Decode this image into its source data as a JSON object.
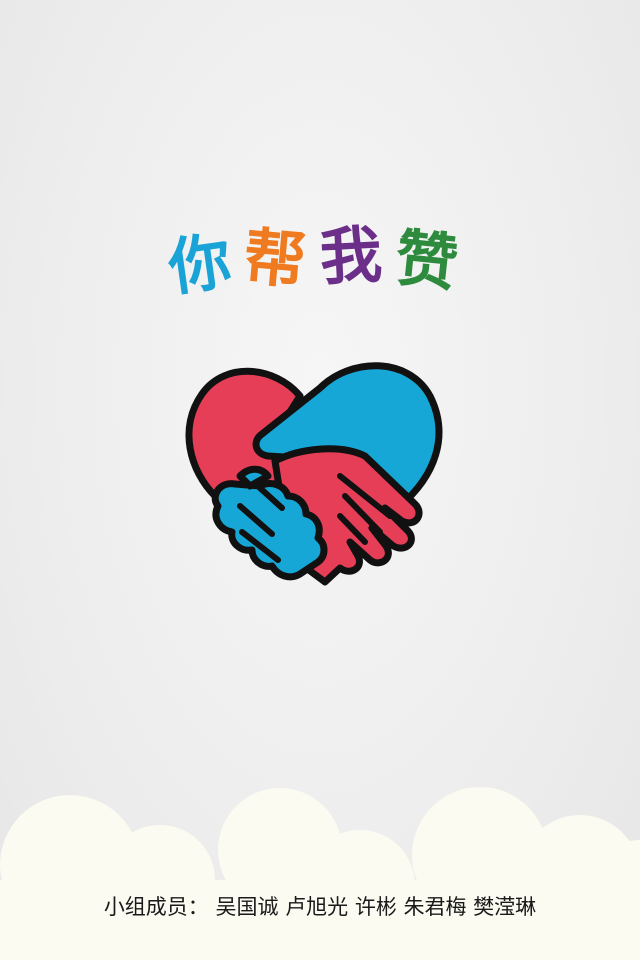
{
  "title": {
    "chars": [
      "你",
      "帮",
      "我",
      "赞"
    ],
    "colors": [
      "#1aa3d6",
      "#ef7a1f",
      "#6b2f8a",
      "#2e8b3e"
    ]
  },
  "logo": {
    "icon": "heart-handshake-icon",
    "colors": {
      "red": "#e63e57",
      "blue": "#17a7d6",
      "outline": "#111111"
    }
  },
  "footer": {
    "members_text": "小组成员： 吴国诚 卢旭光 许彬 朱君梅 樊滢琳"
  }
}
